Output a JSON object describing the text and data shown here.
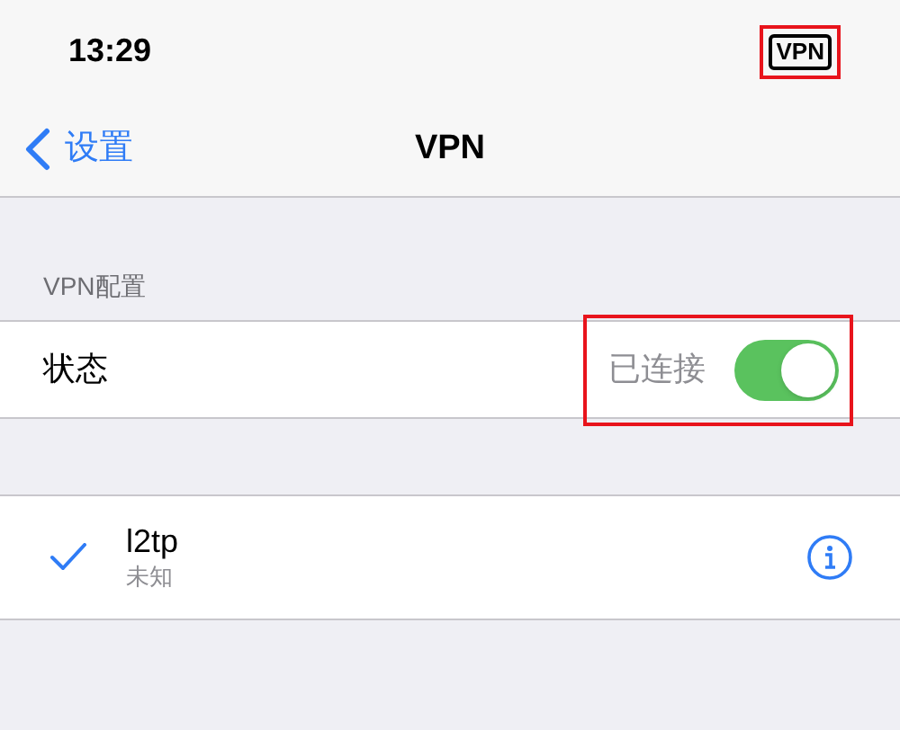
{
  "status_bar": {
    "time": "13:29",
    "vpn_badge": {
      "label": "VPN",
      "highlighted": true
    }
  },
  "nav": {
    "back_label": "设置",
    "title": "VPN"
  },
  "section_header": "VPN配置",
  "status_row": {
    "label": "状态",
    "value": "已连接",
    "on": true,
    "highlighted": true
  },
  "configurations": [
    {
      "name": "l2tp",
      "status": "未知",
      "selected": true
    }
  ]
}
